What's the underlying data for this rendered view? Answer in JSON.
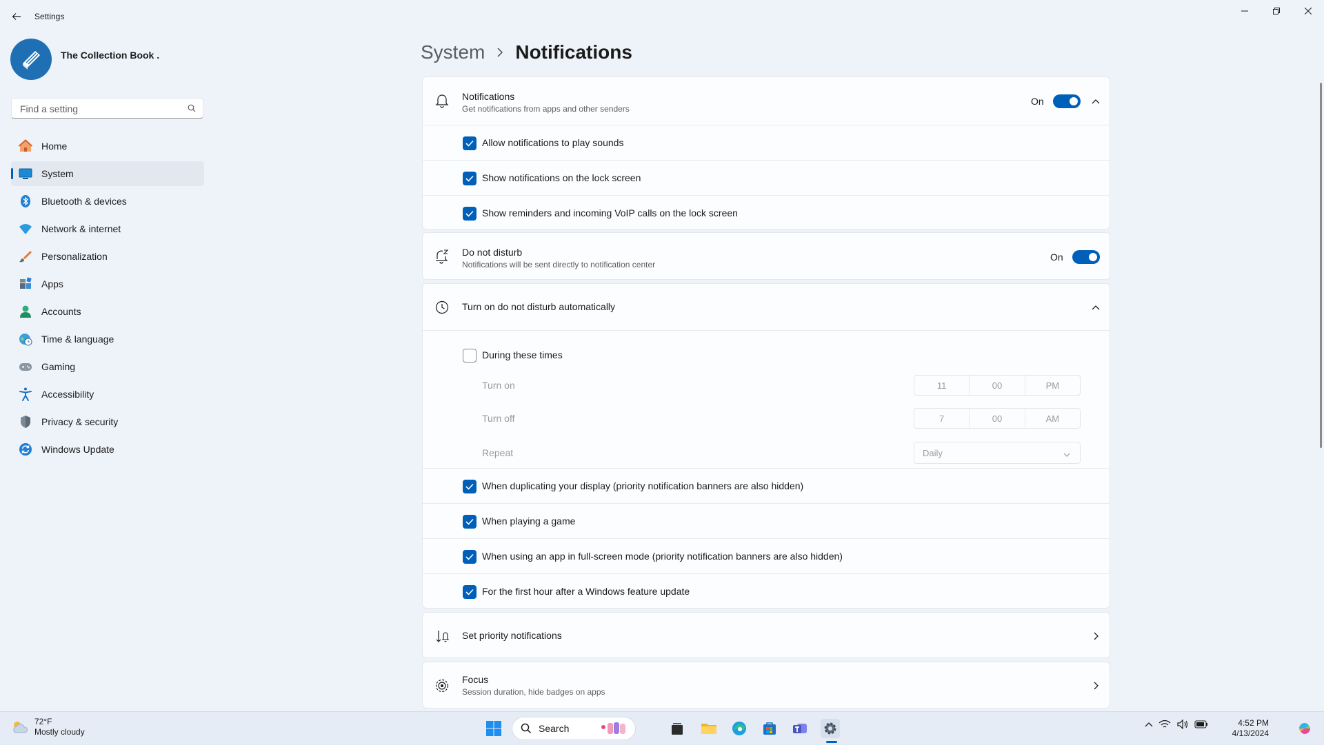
{
  "window": {
    "title": "Settings",
    "controls": {
      "minimize": "minimize",
      "maximize": "restore",
      "close": "close"
    }
  },
  "profile": {
    "name": "The Collection Book ."
  },
  "search": {
    "placeholder": "Find a setting"
  },
  "sidebar": {
    "items": [
      {
        "label": "Home",
        "icon": "home-icon",
        "active": false
      },
      {
        "label": "System",
        "icon": "system-icon",
        "active": true
      },
      {
        "label": "Bluetooth & devices",
        "icon": "bluetooth-icon",
        "active": false
      },
      {
        "label": "Network & internet",
        "icon": "wifi-icon",
        "active": false
      },
      {
        "label": "Personalization",
        "icon": "brush-icon",
        "active": false
      },
      {
        "label": "Apps",
        "icon": "apps-icon",
        "active": false
      },
      {
        "label": "Accounts",
        "icon": "accounts-icon",
        "active": false
      },
      {
        "label": "Time & language",
        "icon": "globe-clock-icon",
        "active": false
      },
      {
        "label": "Gaming",
        "icon": "gamepad-icon",
        "active": false
      },
      {
        "label": "Accessibility",
        "icon": "accessibility-icon",
        "active": false
      },
      {
        "label": "Privacy & security",
        "icon": "shield-icon",
        "active": false
      },
      {
        "label": "Windows Update",
        "icon": "update-icon",
        "active": false
      }
    ]
  },
  "breadcrumb": {
    "parent": "System",
    "current": "Notifications"
  },
  "notifications": {
    "title": "Notifications",
    "subtitle": "Get notifications from apps and other senders",
    "toggle_label": "On",
    "enabled": true,
    "options": [
      {
        "label": "Allow notifications to play sounds",
        "checked": true
      },
      {
        "label": "Show notifications on the lock screen",
        "checked": true
      },
      {
        "label": "Show reminders and incoming VoIP calls on the lock screen",
        "checked": true
      }
    ]
  },
  "dnd": {
    "title": "Do not disturb",
    "subtitle": "Notifications will be sent directly to notification center",
    "toggle_label": "On",
    "enabled": true
  },
  "auto_dnd": {
    "title": "Turn on do not disturb automatically",
    "during_times": {
      "label": "During these times",
      "checked": false
    },
    "turn_on": {
      "label": "Turn on",
      "hour": "11",
      "minute": "00",
      "period": "PM"
    },
    "turn_off": {
      "label": "Turn off",
      "hour": "7",
      "minute": "00",
      "period": "AM"
    },
    "repeat": {
      "label": "Repeat",
      "value": "Daily"
    },
    "options": [
      {
        "label": "When duplicating your display (priority notification banners are also hidden)",
        "checked": true
      },
      {
        "label": "When playing a game",
        "checked": true
      },
      {
        "label": "When using an app in full-screen mode (priority notification banners are also hidden)",
        "checked": true
      },
      {
        "label": "For the first hour after a Windows feature update",
        "checked": true
      }
    ]
  },
  "priority": {
    "title": "Set priority notifications"
  },
  "focus": {
    "title": "Focus",
    "subtitle": "Session duration, hide badges on apps"
  },
  "taskbar": {
    "weather_temp": "72°F",
    "weather_desc": "Mostly cloudy",
    "search_label": "Search",
    "time": "4:52 PM",
    "date": "4/13/2024"
  },
  "colors": {
    "accent": "#005fb8",
    "background": "#eef3fa",
    "card": "#fbfdff"
  }
}
